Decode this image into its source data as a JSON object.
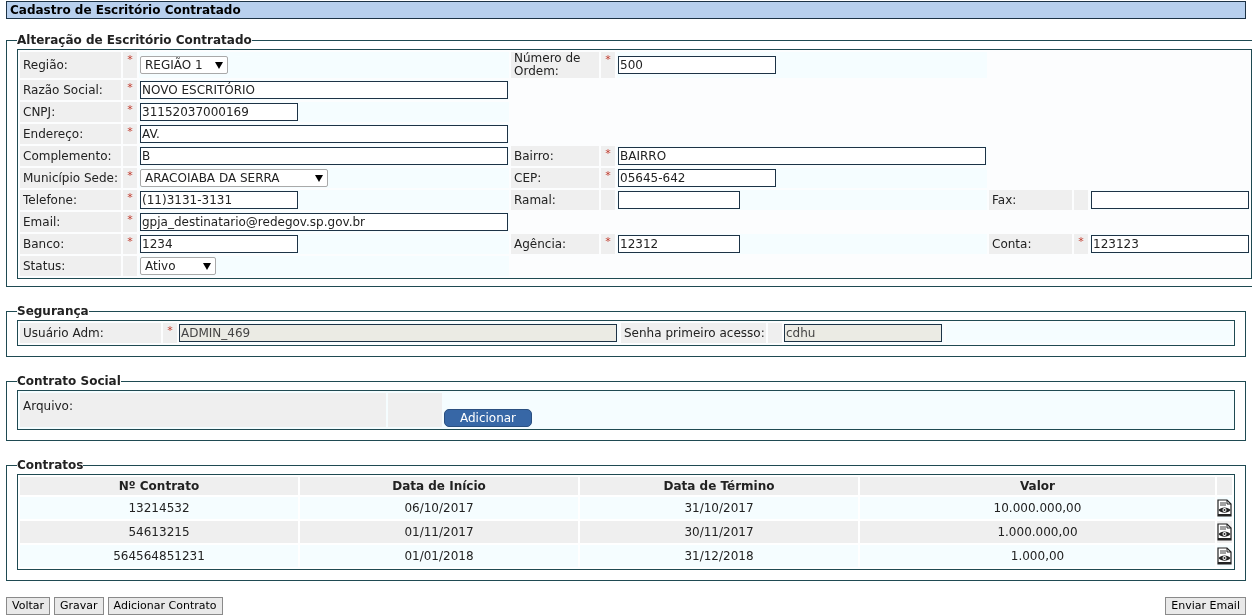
{
  "header": {
    "title": "Cadastro de Escritório Contratado"
  },
  "main_section": {
    "legend": "Alteração de Escritório Contratado",
    "rows": [
      {
        "fields": [
          {
            "label": "Região:",
            "required_mark": "*",
            "kind": "select",
            "value": "REGIÃO 1"
          },
          {
            "label": "Número de Ordem:",
            "required_mark": "*",
            "kind": "text",
            "value": "500"
          }
        ]
      },
      {
        "fields": [
          {
            "label": "Razão Social:",
            "required_mark": "*",
            "kind": "text",
            "value": "NOVO ESCRITÓRIO"
          }
        ]
      },
      {
        "fields": [
          {
            "label": "CNPJ:",
            "required_mark": "*",
            "kind": "text",
            "value": "31152037000169"
          }
        ]
      },
      {
        "fields": [
          {
            "label": "Endereço:",
            "required_mark": "*",
            "kind": "text",
            "value": "AV."
          }
        ]
      },
      {
        "fields": [
          {
            "label": "Complemento:",
            "kind": "text",
            "value": "B"
          },
          {
            "label": "Bairro:",
            "required_mark": "*",
            "kind": "text",
            "value": "BAIRRO"
          }
        ]
      },
      {
        "fields": [
          {
            "label": "Município Sede:",
            "required_mark": "*",
            "kind": "select",
            "value": "ARACOIABA DA SERRA"
          },
          {
            "label": "CEP:",
            "required_mark": "*",
            "kind": "text",
            "value": "05645-642"
          }
        ]
      },
      {
        "fields": [
          {
            "label": "Telefone:",
            "required_mark": "*",
            "kind": "text",
            "value": "(11)3131-3131"
          },
          {
            "label": "Ramal:",
            "kind": "text"
          },
          {
            "label": "Fax:",
            "kind": "text"
          }
        ]
      },
      {
        "fields": [
          {
            "label": "Email:",
            "required_mark": "*",
            "kind": "text",
            "value": "gpja_destinatario@redegov.sp.gov.br"
          }
        ]
      },
      {
        "fields": [
          {
            "label": "Banco:",
            "required_mark": "*",
            "kind": "text",
            "value": "1234"
          },
          {
            "label": "Agência:",
            "required_mark": "*",
            "kind": "text",
            "value": "12312"
          },
          {
            "label": "Conta:",
            "required_mark": "*",
            "kind": "text",
            "value": "123123"
          }
        ]
      },
      {
        "fields": [
          {
            "label": "Status:",
            "kind": "select",
            "value": "Ativo"
          }
        ]
      }
    ]
  },
  "security": {
    "legend": "Segurança",
    "fields": [
      {
        "label": "Usuário Adm:",
        "required_mark": "*",
        "value": "ADMIN_469",
        "disabled": true
      },
      {
        "label": "Senha primeiro acesso:",
        "value": "cdhu",
        "disabled": true
      }
    ]
  },
  "social_contract": {
    "legend": "Contrato Social",
    "label": "Arquivo:",
    "button": "Adicionar"
  },
  "contracts": {
    "legend": "Contratos",
    "columns": [
      "Nº Contrato",
      "Data de Início",
      "Data de Término",
      "Valor"
    ],
    "rows": [
      {
        "cells": [
          "13214532",
          "06/10/2017",
          "31/10/2017",
          "10.000.000,00"
        ]
      },
      {
        "cells": [
          "54613215",
          "01/11/2017",
          "30/11/2017",
          "1.000.000,00"
        ]
      },
      {
        "cells": [
          "564564851231",
          "01/01/2018",
          "31/12/2018",
          "1.000,00"
        ]
      }
    ]
  },
  "buttons_left": [
    "Voltar",
    "Gravar",
    "Adicionar Contrato"
  ],
  "buttons_right": [
    "Enviar Email"
  ]
}
